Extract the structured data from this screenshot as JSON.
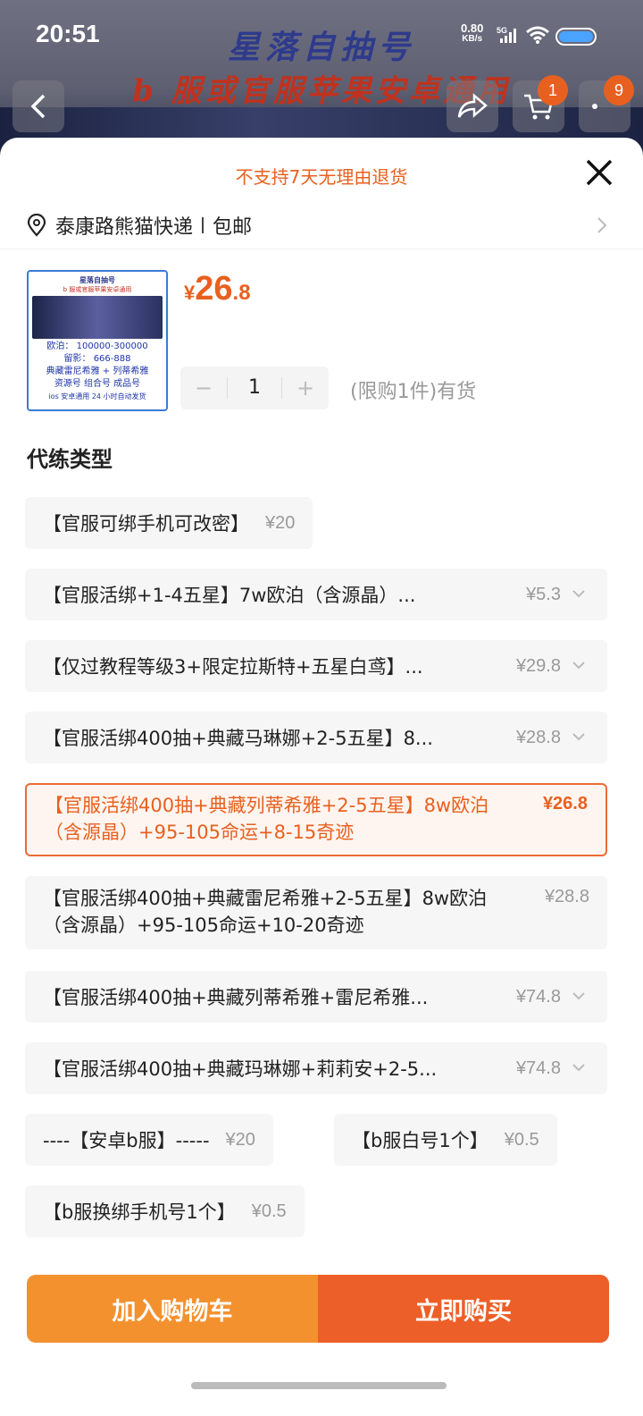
{
  "status": {
    "time": "20:51",
    "net_speed": "0.80",
    "net_unit": "KB/s",
    "signal": "5G"
  },
  "banner": {
    "line1": "星落自抽号",
    "line2": "b 服或官服苹果安卓通用"
  },
  "top_buttons": {
    "cart_badge": "1",
    "more_badge": "9"
  },
  "notice": "不支持7天无理由退货",
  "address": {
    "location": "泰康路熊猫快递",
    "shipping": "包邮"
  },
  "product": {
    "thumb": {
      "title": "星落自抽号",
      "subtitle": "b 服或官服苹果安卓通用",
      "lines": [
        "欧泊： 100000-300000",
        "留影： 666-888",
        "典藏雷尼希雅 + 列蒂希雅",
        "资源号 组合号 成品号",
        "ios 安卓通用    24 小时自动发货"
      ]
    },
    "price_currency": "¥",
    "price_int": "26",
    "price_dec": ".8",
    "quantity": "1",
    "stock": "(限购1件)有货"
  },
  "section_title": "代练类型",
  "options": [
    {
      "name": "【官服可绑手机可改密】",
      "price": "¥20"
    },
    {
      "name": "【官服活绑+1-4五星】7w欧泊（含源晶）...",
      "price": "¥5.3"
    },
    {
      "name": "【仅过教程等级3+限定拉斯特+五星白鸢】...",
      "price": "¥29.8"
    },
    {
      "name": "【官服活绑400抽+典藏马琳娜+2-5五星】8...",
      "price": "¥28.8"
    },
    {
      "name": "【官服活绑400抽+典藏列蒂希雅+2-5五星】8w欧泊（含源晶）+95-105命运+8-15奇迹",
      "price": "¥26.8"
    },
    {
      "name": "【官服活绑400抽+典藏雷尼希雅+2-5五星】8w欧泊（含源晶）+95-105命运+10-20奇迹",
      "price": "¥28.8"
    },
    {
      "name": "【官服活绑400抽+典藏列蒂希雅+雷尼希雅...",
      "price": "¥74.8"
    },
    {
      "name": "【官服活绑400抽+典藏玛琳娜+莉莉安+2-5...",
      "price": "¥74.8"
    },
    {
      "name": "----【安卓b服】-----",
      "price": "¥20"
    },
    {
      "name": "【b服白号1个】",
      "price": "¥0.5"
    },
    {
      "name": "【b服换绑手机号1个】",
      "price": "¥0.5"
    }
  ],
  "buttons": {
    "add_to_cart": "加入购物车",
    "buy_now": "立即购买"
  },
  "colors": {
    "accent": "#e8601f",
    "cart": "#f3912f",
    "buy": "#ed5f28"
  }
}
